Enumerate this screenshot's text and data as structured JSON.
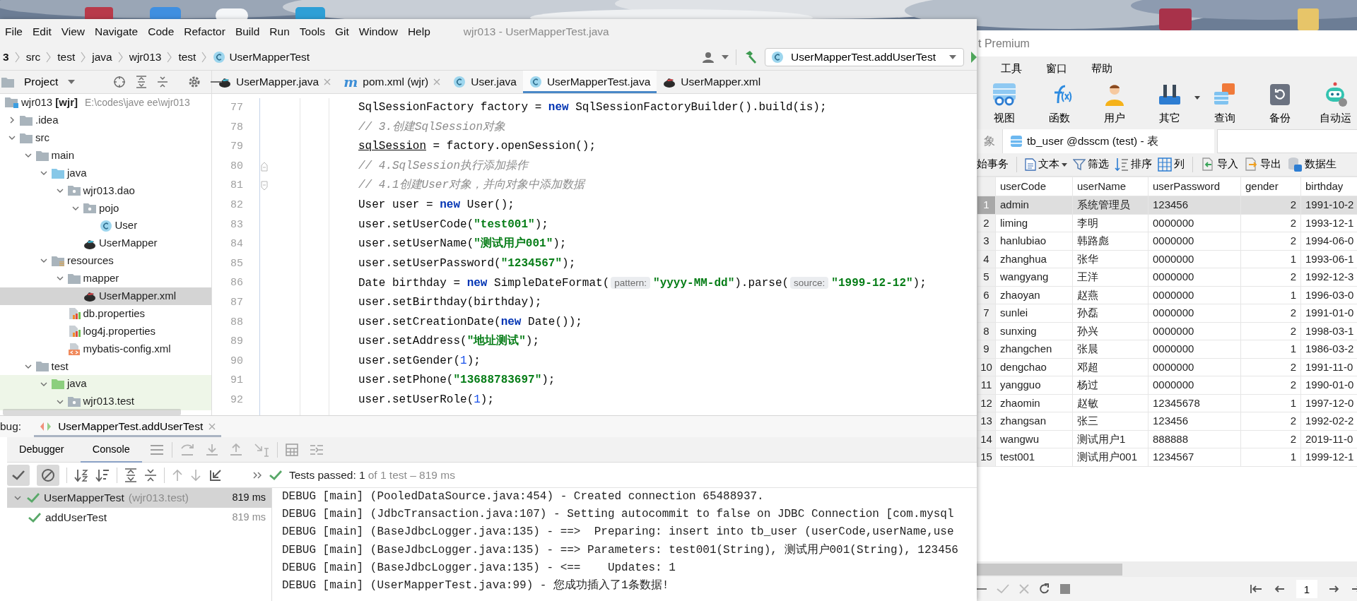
{
  "ide": {
    "menu": [
      "File",
      "Edit",
      "View",
      "Navigate",
      "Code",
      "Refactor",
      "Build",
      "Run",
      "Tools",
      "Git",
      "Window",
      "Help"
    ],
    "title": "wjr013 - UserMapperTest.java",
    "breadcrumbs": [
      {
        "label": "3",
        "kind": "root"
      },
      {
        "label": "src",
        "kind": "plain"
      },
      {
        "label": "test",
        "kind": "plain"
      },
      {
        "label": "java",
        "kind": "plain"
      },
      {
        "label": "wjr013",
        "kind": "plain"
      },
      {
        "label": "test",
        "kind": "plain"
      },
      {
        "label": "UserMapperTest",
        "kind": "class"
      }
    ],
    "run_config": "UserMapperTest.addUserTest",
    "project": {
      "title": "Project",
      "tree": [
        {
          "label": "wjr013 **[wjr]**",
          "path": "E:\\codes\\jave ee\\wjr013",
          "kind": "module",
          "selected": false,
          "children": [
            {
              "label": ".idea",
              "kind": "folder",
              "expanded": false,
              "selected": false
            },
            {
              "label": "src",
              "kind": "folder",
              "expanded": true,
              "selected": false,
              "children": [
                {
                  "label": "main",
                  "kind": "folder",
                  "expanded": true,
                  "selected": false,
                  "children": [
                    {
                      "label": "java",
                      "kind": "source-folder",
                      "expanded": true,
                      "selected": false,
                      "children": [
                        {
                          "label": "wjr013.dao",
                          "kind": "package",
                          "expanded": true,
                          "selected": false,
                          "children": [
                            {
                              "label": "pojo",
                              "kind": "package",
                              "expanded": true,
                              "selected": false,
                              "children": [
                                {
                                  "label": "User",
                                  "kind": "class",
                                  "selected": false
                                }
                              ]
                            },
                            {
                              "label": "UserMapper",
                              "kind": "mapper",
                              "selected": false
                            }
                          ]
                        }
                      ]
                    },
                    {
                      "label": "resources",
                      "kind": "resource-folder",
                      "expanded": true,
                      "selected": false,
                      "children": [
                        {
                          "label": "mapper",
                          "kind": "folder",
                          "expanded": true,
                          "selected": false,
                          "children": [
                            {
                              "label": "UserMapper.xml",
                              "kind": "mapper-xml",
                              "selected": true
                            }
                          ]
                        },
                        {
                          "label": "db.properties",
                          "kind": "properties",
                          "selected": false
                        },
                        {
                          "label": "log4j.properties",
                          "kind": "properties",
                          "selected": false
                        },
                        {
                          "label": "mybatis-config.xml",
                          "kind": "xml",
                          "selected": false
                        }
                      ]
                    }
                  ]
                },
                {
                  "label": "test",
                  "kind": "folder",
                  "expanded": true,
                  "selected": false,
                  "children": [
                    {
                      "label": "java",
                      "kind": "test-folder",
                      "expanded": true,
                      "selected": false,
                      "children": [
                        {
                          "label": "wjr013.test",
                          "kind": "package",
                          "expanded": true,
                          "selected": false
                        }
                      ]
                    }
                  ]
                }
              ]
            }
          ]
        }
      ]
    },
    "tabs": [
      {
        "label": "UserMapper.java",
        "kind": "mapper",
        "selected": false
      },
      {
        "label": "pom.xml (wjr)",
        "kind": "letter",
        "icon_text": "m",
        "selected": false
      },
      {
        "label": "User.java",
        "kind": "class",
        "selected": false
      },
      {
        "label": "UserMapperTest.java",
        "kind": "class",
        "selected": true
      },
      {
        "label": "UserMapper.xml",
        "kind": "mapper-xml",
        "selected": false
      }
    ],
    "code": [
      {
        "number": "77",
        "segments": [
          {
            "kind": "plain",
            "text": "SqlSessionFactory factory = "
          },
          {
            "kind": "kw",
            "text": "new"
          },
          {
            "kind": "plain",
            "text": " SqlSessionFactoryBuilder().build(is);"
          }
        ]
      },
      {
        "number": "78",
        "segments": [
          {
            "kind": "com",
            "text": "// 3.创建SqlSession对象"
          }
        ]
      },
      {
        "number": "79",
        "segments": [
          {
            "kind": "field",
            "text": "sqlSession"
          },
          {
            "kind": "plain",
            "text": " = factory.openSession();"
          }
        ]
      },
      {
        "number": "80",
        "fold": true,
        "segments": [
          {
            "kind": "com",
            "text": "// 4.SqlSession执行添加操作"
          }
        ]
      },
      {
        "number": "81",
        "fold": true,
        "segments": [
          {
            "kind": "com",
            "text": "// 4.1创建User对象，并向对象中添加数据"
          }
        ]
      },
      {
        "number": "82",
        "segments": [
          {
            "kind": "plain",
            "text": "User user = "
          },
          {
            "kind": "kw",
            "text": "new"
          },
          {
            "kind": "plain",
            "text": " User();"
          }
        ]
      },
      {
        "number": "83",
        "segments": [
          {
            "kind": "plain",
            "text": "user.setUserCode("
          },
          {
            "kind": "str",
            "text": "\"test001\""
          },
          {
            "kind": "plain",
            "text": ");"
          }
        ]
      },
      {
        "number": "84",
        "segments": [
          {
            "kind": "plain",
            "text": "user.setUserName("
          },
          {
            "kind": "str",
            "text": "\"测试用户001\""
          },
          {
            "kind": "plain",
            "text": ");"
          }
        ]
      },
      {
        "number": "85",
        "segments": [
          {
            "kind": "plain",
            "text": "user.setUserPassword("
          },
          {
            "kind": "str",
            "text": "\"1234567\""
          },
          {
            "kind": "plain",
            "text": ");"
          }
        ]
      },
      {
        "number": "86",
        "segments": [
          {
            "kind": "plain",
            "text": "Date birthday = "
          },
          {
            "kind": "kw",
            "text": "new"
          },
          {
            "kind": "plain",
            "text": " SimpleDateFormat("
          },
          {
            "kind": "hint",
            "text": "pattern:"
          },
          {
            "kind": "str",
            "text": "\"yyyy-MM-dd\""
          },
          {
            "kind": "plain",
            "text": ").parse("
          },
          {
            "kind": "hint",
            "text": "source:"
          },
          {
            "kind": "str",
            "text": "\"1999-12-12\""
          },
          {
            "kind": "plain",
            "text": ");"
          }
        ]
      },
      {
        "number": "87",
        "segments": [
          {
            "kind": "plain",
            "text": "user.setBirthday(birthday);"
          }
        ]
      },
      {
        "number": "88",
        "segments": [
          {
            "kind": "plain",
            "text": "user.setCreationDate("
          },
          {
            "kind": "kw",
            "text": "new"
          },
          {
            "kind": "plain",
            "text": " Date());"
          }
        ]
      },
      {
        "number": "89",
        "segments": [
          {
            "kind": "plain",
            "text": "user.setAddress("
          },
          {
            "kind": "str",
            "text": "\"地址测试\""
          },
          {
            "kind": "plain",
            "text": ");"
          }
        ]
      },
      {
        "number": "90",
        "segments": [
          {
            "kind": "plain",
            "text": "user.setGender("
          },
          {
            "kind": "num",
            "text": "1"
          },
          {
            "kind": "plain",
            "text": ");"
          }
        ]
      },
      {
        "number": "91",
        "segments": [
          {
            "kind": "plain",
            "text": "user.setPhone("
          },
          {
            "kind": "str",
            "text": "\"13688783697\""
          },
          {
            "kind": "plain",
            "text": ");"
          }
        ]
      },
      {
        "number": "92",
        "segments": [
          {
            "kind": "plain",
            "text": "user.setUserRole("
          },
          {
            "kind": "num",
            "text": "1"
          },
          {
            "kind": "plain",
            "text": ");"
          }
        ]
      }
    ],
    "debug": {
      "label": "bug:",
      "tab": {
        "label": "UserMapperTest.addUserTest",
        "selected": true
      },
      "views": [
        {
          "label": "Debugger",
          "selected": false
        },
        {
          "label": "Console",
          "selected": true
        }
      ],
      "filters": [
        {
          "kind": "passed",
          "on": true
        },
        {
          "kind": "ignored",
          "on": true
        }
      ],
      "status": {
        "headline": "Tests passed: 1",
        "detail": "of 1 test – 819 ms"
      },
      "tests": [
        {
          "label": "UserMapperTest",
          "detail": "(wjr013.test)",
          "time": "819 ms",
          "passed": true,
          "expanded": true,
          "selected": true,
          "children": [
            {
              "label": "addUserTest",
              "time": "819 ms",
              "passed": true,
              "selected": false
            }
          ]
        }
      ],
      "console": [
        "DEBUG [main] (PooledDataSource.java:454) - Created connection 65488937.",
        "DEBUG [main] (JdbcTransaction.java:107) - Setting autocommit to false on JDBC Connection [com.mysql",
        "DEBUG [main] (BaseJdbcLogger.java:135) - ==>  Preparing: insert into tb_user (userCode,userName,use",
        "DEBUG [main] (BaseJdbcLogger.java:135) - ==> Parameters: test001(String), 测试用户001(String), 123456",
        "DEBUG [main] (BaseJdbcLogger.java:135) - <==    Updates: 1",
        "DEBUG [main] (UserMapperTest.java:99) - 您成功插入了1条数据!"
      ]
    }
  },
  "navicat": {
    "title": "t Premium",
    "menu": [
      "工具",
      "窗口",
      "帮助"
    ],
    "toolbar": [
      {
        "label": "视图",
        "kind": "view"
      },
      {
        "label": "函数",
        "kind": "function"
      },
      {
        "label": "用户",
        "kind": "user"
      },
      {
        "label": "其它",
        "kind": "tools",
        "dropdown": true
      },
      {
        "label": "查询",
        "kind": "query"
      },
      {
        "label": "备份",
        "kind": "backup"
      },
      {
        "label": "自动运",
        "kind": "robot"
      }
    ],
    "tabs": [
      {
        "label": "象",
        "kind": "objects",
        "selected": false
      },
      {
        "label": "tb_user @dsscm (test) - 表",
        "kind": "table",
        "selected": true
      }
    ],
    "actions": [
      [
        {
          "label": "始事务",
          "kind": "none"
        }
      ],
      [
        {
          "label": "文本",
          "kind": "text",
          "dropdown": true
        },
        {
          "label": "筛选",
          "kind": "filter"
        },
        {
          "label": "排序",
          "kind": "sort"
        },
        {
          "label": "列",
          "kind": "columns"
        }
      ],
      [
        {
          "label": "导入",
          "kind": "import"
        },
        {
          "label": "导出",
          "kind": "export"
        },
        {
          "label": "数据生",
          "kind": "generate"
        }
      ]
    ],
    "table": {
      "columns": [
        "userCode",
        "userName",
        "userPassword",
        "gender",
        "birthday"
      ],
      "rows": [
        {
          "number": "1",
          "cells": [
            "admin",
            "系统管理员",
            "123456",
            "2",
            "1991-10-2"
          ],
          "selected": true
        },
        {
          "number": "2",
          "cells": [
            "liming",
            "李明",
            "0000000",
            "2",
            "1993-12-1"
          ],
          "selected": false
        },
        {
          "number": "3",
          "cells": [
            "hanlubiao",
            "韩路彪",
            "0000000",
            "2",
            "1994-06-0"
          ],
          "selected": false
        },
        {
          "number": "4",
          "cells": [
            "zhanghua",
            "张华",
            "0000000",
            "1",
            "1993-06-1"
          ],
          "selected": false
        },
        {
          "number": "5",
          "cells": [
            "wangyang",
            "王洋",
            "0000000",
            "2",
            "1992-12-3"
          ],
          "selected": false
        },
        {
          "number": "6",
          "cells": [
            "zhaoyan",
            "赵燕",
            "0000000",
            "1",
            "1996-03-0"
          ],
          "selected": false
        },
        {
          "number": "7",
          "cells": [
            "sunlei",
            "孙磊",
            "0000000",
            "2",
            "1991-01-0"
          ],
          "selected": false
        },
        {
          "number": "8",
          "cells": [
            "sunxing",
            "孙兴",
            "0000000",
            "2",
            "1998-03-1"
          ],
          "selected": false
        },
        {
          "number": "9",
          "cells": [
            "zhangchen",
            "张晨",
            "0000000",
            "1",
            "1986-03-2"
          ],
          "selected": false
        },
        {
          "number": "10",
          "cells": [
            "dengchao",
            "邓超",
            "0000000",
            "2",
            "1991-11-0"
          ],
          "selected": false
        },
        {
          "number": "11",
          "cells": [
            "yangguo",
            "杨过",
            "0000000",
            "2",
            "1990-01-0"
          ],
          "selected": false
        },
        {
          "number": "12",
          "cells": [
            "zhaomin",
            "赵敏",
            "12345678",
            "1",
            "1997-12-0"
          ],
          "selected": false
        },
        {
          "number": "13",
          "cells": [
            "zhangsan",
            "张三",
            "123456",
            "2",
            "1992-02-2"
          ],
          "selected": false
        },
        {
          "number": "14",
          "cells": [
            "wangwu",
            "测试用户1",
            "888888",
            "2",
            "2019-11-0"
          ],
          "selected": false
        },
        {
          "number": "15",
          "cells": [
            "test001",
            "测试用户001",
            "1234567",
            "1",
            "1999-12-1"
          ],
          "selected": false
        }
      ]
    },
    "record_tools": [
      {
        "kind": "remove",
        "disabled": false
      },
      {
        "kind": "apply",
        "disabled": true
      },
      {
        "kind": "discard",
        "disabled": true
      },
      {
        "kind": "refresh",
        "disabled": false
      },
      {
        "kind": "stop",
        "disabled": false
      }
    ],
    "pager": {
      "page": "1"
    }
  }
}
